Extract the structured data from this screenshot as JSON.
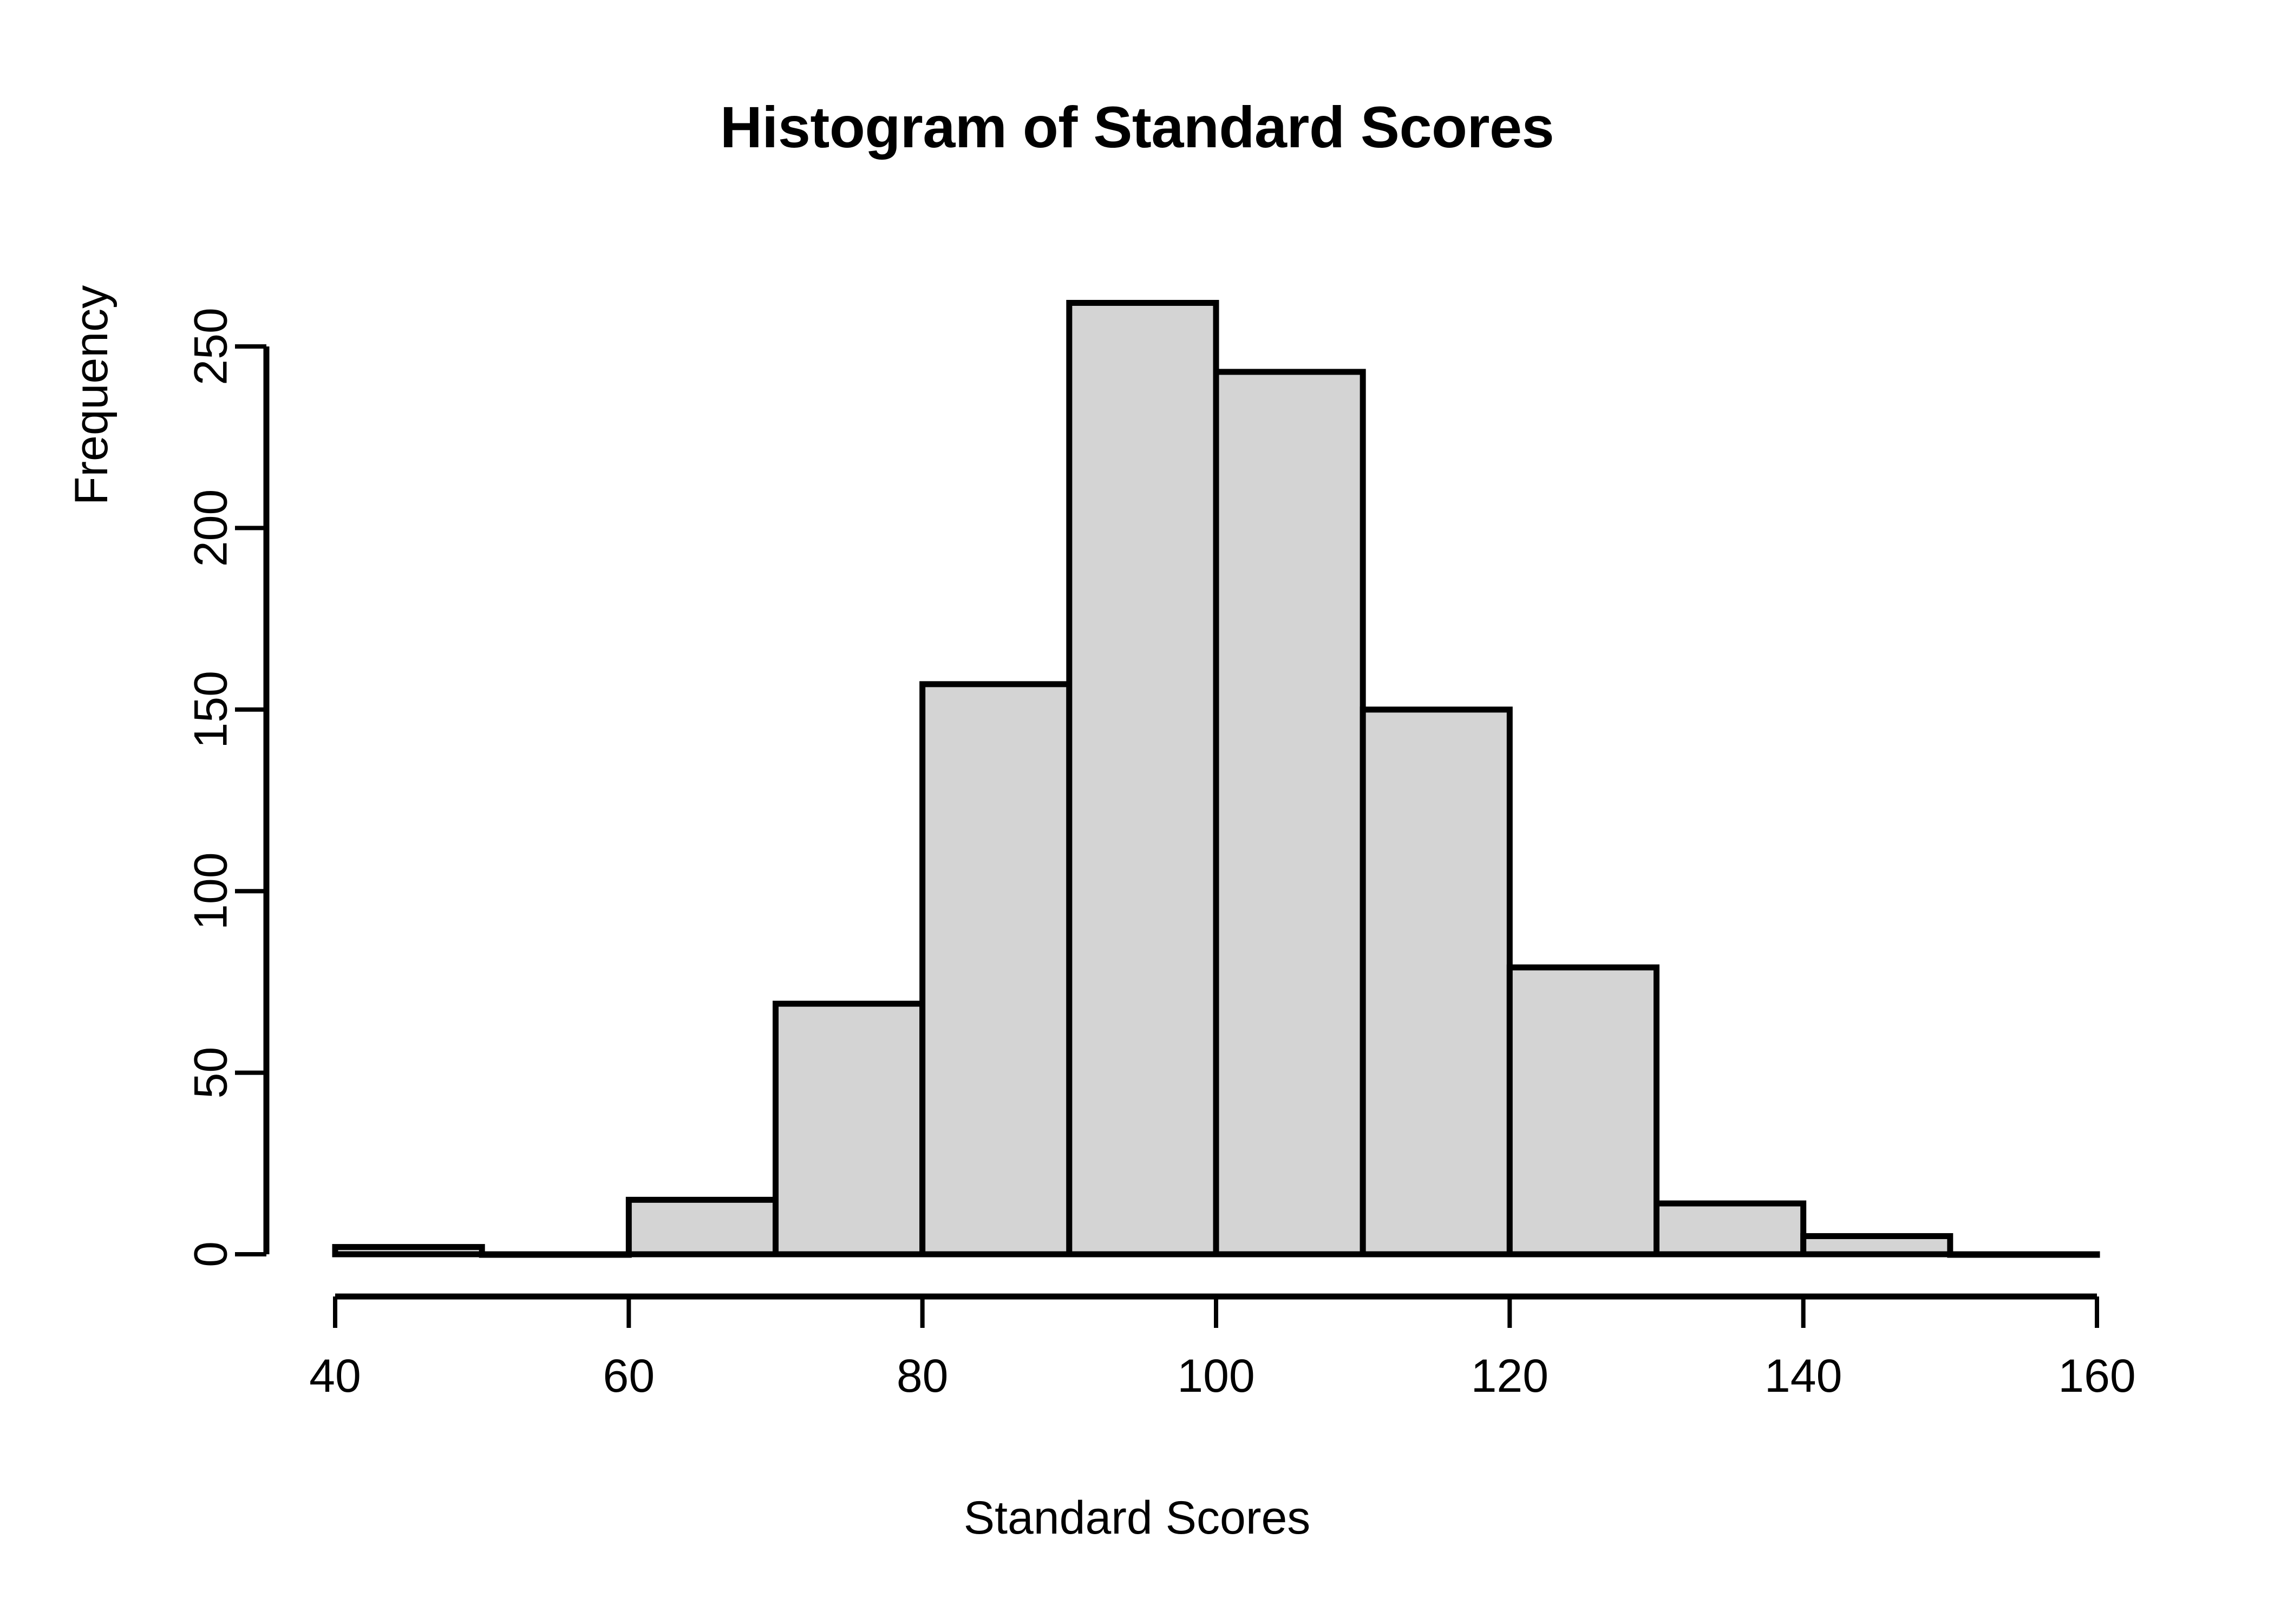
{
  "chart_data": {
    "type": "bar",
    "title": "Histogram of Standard Scores",
    "xlabel": "Standard Scores",
    "ylabel": "Frequency",
    "categories": [
      "40-50",
      "50-60",
      "60-70",
      "70-80",
      "80-90",
      "90-100",
      "100-110",
      "110-120",
      "120-130",
      "130-140",
      "140-150",
      "150-160"
    ],
    "bin_edges": [
      40,
      50,
      60,
      70,
      80,
      90,
      100,
      110,
      120,
      130,
      140,
      150,
      160
    ],
    "values": [
      2,
      0,
      15,
      69,
      157,
      262,
      243,
      150,
      79,
      14,
      5,
      0
    ],
    "bin_width": 10,
    "xlim": [
      40,
      160
    ],
    "ylim": [
      0,
      262
    ],
    "x_ticks": [
      40,
      60,
      80,
      100,
      120,
      140,
      160
    ],
    "y_ticks": [
      0,
      50,
      100,
      150,
      200,
      250
    ],
    "x_tick_labels": [
      "40",
      "60",
      "80",
      "100",
      "120",
      "140",
      "160"
    ],
    "y_tick_labels": [
      "0",
      "50",
      "100",
      "150",
      "200",
      "250"
    ],
    "grid": false,
    "legend": null,
    "bar_fill_color": "#d4d4d4",
    "bar_border_color": "#000000",
    "background_color": "#ffffff",
    "axis_color": "#000000"
  }
}
